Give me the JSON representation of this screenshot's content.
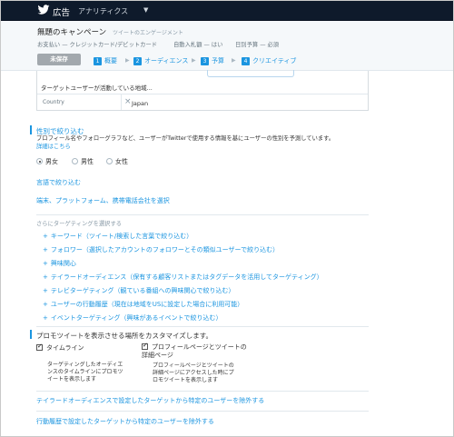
{
  "topbar": {
    "ads_label": "広告",
    "analytics_label": "アナリティクス",
    "bg_color": "#0e1a2b"
  },
  "header": {
    "campaign_title": "無題のキャンペーン",
    "campaign_type": "ツイートのエンゲージメント",
    "meta_payment": "お支払い — クレジットカード/デビットカード",
    "meta_autobid": "自動入札額 — はい",
    "meta_daily": "日別予算 — 必須",
    "save_label": "未保存",
    "steps": [
      {
        "num": "1",
        "label": "概要"
      },
      {
        "num": "2",
        "label": "オーディエンス"
      },
      {
        "num": "3",
        "label": "予算"
      },
      {
        "num": "4",
        "label": "クリエイティブ"
      }
    ]
  },
  "location": {
    "suggest_text": "ターゲットユーザーが活動している地域...",
    "country_label": "Country",
    "country_value": "Japan"
  },
  "gender": {
    "title": "性別で絞り込む",
    "desc": "プロフィール名やフォローグラフなど、ユーザーがTwitterで使用する情報を基にユーザーの性別を予測しています。",
    "link": "詳細はこちら",
    "options": [
      "男女",
      "男性",
      "女性"
    ]
  },
  "language_link": "言語で絞り込む",
  "device_link": "端末、プラットフォーム、携帯電話会社を選択",
  "more_targeting": {
    "heading": "さらにターゲティングを選択する",
    "items": [
      "キーワード（ツイート/検索した言葉で絞り込む）",
      "フォロワー（選択したアカウントのフォロワーとその類似ユーザーで絞り込む）",
      "興味関心",
      "テイラードオーディエンス（保有する顧客リストまたはタグデータを活用してターゲティング）",
      "テレビターゲティング（観ている番組への興味関心で絞り込む）",
      "ユーザーの行動履歴（現在は地域をUSに設定した場合に利用可能）",
      "イベントターゲティング（興味があるイベントで絞り込む）"
    ]
  },
  "placement": {
    "title": "プロモツイートを表示させる場所をカスタマイズします。",
    "timeline_label": "タイムライン",
    "timeline_desc": "ターゲティングしたオーディエンスのタイムラインにプロモツイートを表示します",
    "profile_label": "プロフィールページとツイートの詳細ページ",
    "profile_desc": "プロフィールページとツイートの詳細ページにアクセスした時にプロモツイートを表示します"
  },
  "exclude_tailored": "テイラードオーディエンスで設定したターゲットから特定のユーザーを除外する",
  "exclude_behavior": "行動履歴で設定したターゲットから特定のユーザーを除外する",
  "colors": {
    "accent": "#1b95e0"
  },
  "icons": {
    "logo": "twitter-bird-icon",
    "dropdown": "chevron-down-icon",
    "remove": "close-icon"
  }
}
